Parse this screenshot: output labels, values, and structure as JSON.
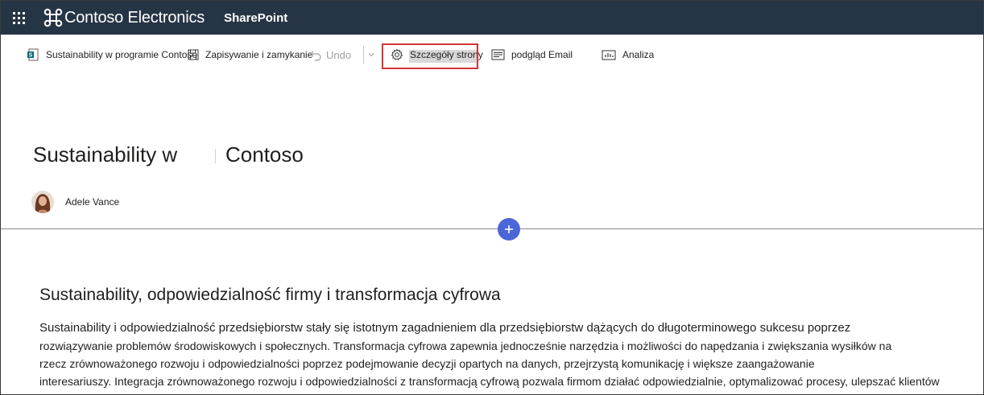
{
  "suite_bar": {
    "brand_name": "Contoso Electronics",
    "app_name": "SharePoint",
    "background": "#263545"
  },
  "command_bar": {
    "page_name": "Sustainability w programie Contoso",
    "save_close_label": "Zapisywanie i zamykanie",
    "undo_label": "Undo",
    "page_details_label": "Szczegóły strony",
    "email_preview_label": "podgląd Email",
    "analytics_label": "Analiza"
  },
  "page": {
    "title_part1": "Sustainability w",
    "title_part2": "Contoso",
    "author_name": "Adele Vance"
  },
  "content": {
    "heading": "Sustainability, odpowiedzialność firmy i transformacja cyfrowa",
    "lines": [
      "Sustainability i odpowiedzialność przedsiębiorstw stały się istotnym zagadnieniem dla przedsiębiorstw dążących do długoterminowego sukcesu poprzez",
      "rozwiązywanie problemów środowiskowych i społecznych. Transformacja cyfrowa zapewnia jednocześnie narzędzia i możliwości do napędzania i zwiększania wysiłków na",
      "rzecz zrównoważonego rozwoju i odpowiedzialności poprzez podejmowanie decyzji opartych na danych, przejrzystą komunikację i większe zaangażowanie",
      "interesariuszy. Integracja zrównoważonego rozwoju i odpowiedzialności z transformacją cyfrową pozwala firmom działać odpowiedzialnie, optymalizować procesy, ulepszać klientów"
    ]
  },
  "colors": {
    "accent_add": "#4b66d6",
    "highlight_border": "#d13438"
  },
  "icons": [
    "waffle-icon",
    "contoso-logo-icon",
    "sharepoint-page-icon",
    "save-icon",
    "undo-icon",
    "chevron-down-icon",
    "gear-icon",
    "email-preview-icon",
    "analytics-icon",
    "plus-icon"
  ]
}
